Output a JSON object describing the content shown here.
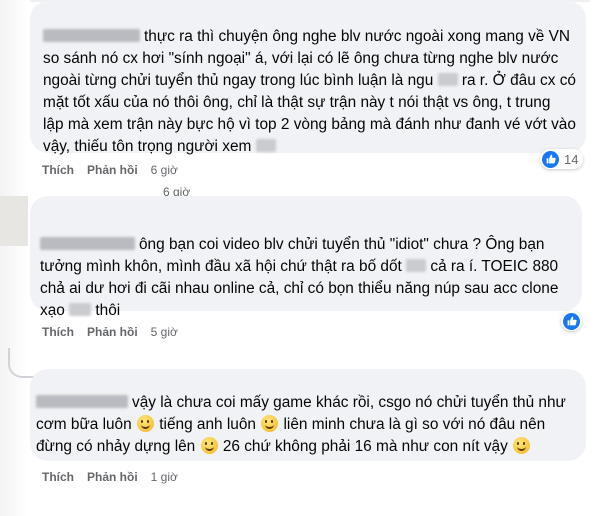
{
  "comments": [
    {
      "text": "thực ra thì chuyện ông nghe blv nước ngoài xong mang về VN so sánh nó cx hơi \"sính ngoại\" á, với lại có lẽ ông chưa từng nghe blv nước ngoài từng chửi tuyển thủ ngay trong lúc bình luận là ngu ra r. Ở đâu cx có mặt tốt xấu của nó thôi ông, chỉ là thật sự trận này t nói thật vs ông, t trung lập mà xem trận này bực hộ vì top 2 vòng bảng mà đánh như đanh vé vớt vào vậy, thiếu tôn trọng người xem",
      "line1": "thực ra thì chuyện ông nghe blv nước ngoài xong mang về VN",
      "line2": "so sánh nó cx hơi \"sính ngoại\" á, với lại có lẽ ông chưa từng nghe blv nước",
      "line3a": "ngoài từng chửi tuyển thủ ngay trong lúc bình luận là ngu",
      "line3b": "ra r. Ở đâu cx có",
      "line4": "mặt tốt xấu của nó thôi ông, chỉ là thật sự trận này t nói thật vs ông, t trung",
      "line5": "lập mà xem trận này bực hộ vì top 2 vòng bảng mà đánh như đanh vé vớt vào",
      "line6": "vậy, thiếu tôn trọng người xem",
      "like_label": "Thích",
      "reply_label": "Phản hồi",
      "time": "6 giờ",
      "reaction_count": "14"
    },
    {
      "line1": "ông bạn coi video blv chửi tuyển thủ \"idiot\" chưa ? Ông bạn",
      "line2": "tưởng mình khôn, mình đầu xã hội chứ thật ra bố dốt",
      "line2b": "cả ra í. TOEIC 880",
      "line3": "chả ai dư hơi đi cãi nhau online cả, chỉ có bọn thiểu năng núp sau acc clone",
      "line4a": "xạo",
      "line4b": "thôi",
      "like_label": "Thích",
      "reply_label": "Phản hồi",
      "time": "5 giờ"
    },
    {
      "line1": "vậy là chưa coi mấy game khác rồi, csgo nó chửi tuyển thủ như",
      "line2a": "cơm bữa luôn",
      "line2b": "tiếng anh luôn",
      "line2c": "liên minh chưa là gì so với nó đâu nên",
      "line3a": "đừng có nhảy dựng lên",
      "line3b": "26 chứ không phải 16 mà như con nít vậy",
      "like_label": "Thích",
      "reply_label": "Phản hồi",
      "time": "1 giờ"
    }
  ],
  "hidden_time": "6 giờ",
  "colors": {
    "bubble": "#f0f2f5",
    "like_blue": "#1877f2",
    "meta": "#65676b"
  },
  "icons": [
    "like-icon",
    "smile-emoji-icon"
  ]
}
